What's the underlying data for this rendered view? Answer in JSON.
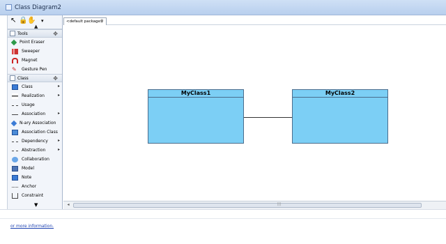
{
  "window": {
    "title": "Class Diagram2"
  },
  "palette": {
    "tools_group": "Tools",
    "tools": [
      "Point Eraser",
      "Sweeper",
      "Magnet",
      "Gesture Pen"
    ],
    "class_group": "Class",
    "class_items": [
      {
        "label": "Class",
        "arrow": true
      },
      {
        "label": "Realization",
        "arrow": true
      },
      {
        "label": "Usage",
        "arrow": false
      },
      {
        "label": "Association",
        "arrow": true
      },
      {
        "label": "N-ary Association",
        "arrow": false
      },
      {
        "label": "Association Class",
        "arrow": false
      },
      {
        "label": "Dependency",
        "arrow": true
      },
      {
        "label": "Abstraction",
        "arrow": true
      },
      {
        "label": "Collaboration",
        "arrow": false
      },
      {
        "label": "Model",
        "arrow": false
      },
      {
        "label": "Note",
        "arrow": false
      },
      {
        "label": "Anchor",
        "arrow": false
      },
      {
        "label": "Constraint",
        "arrow": false
      }
    ]
  },
  "diagram": {
    "package_label": "<default package>",
    "classes": [
      "MyClass1",
      "MyClass2"
    ]
  },
  "status": {
    "link_text": "or more information."
  },
  "colors": {
    "class_fill": "#7ccff5",
    "class_border": "#4a6c8c"
  }
}
